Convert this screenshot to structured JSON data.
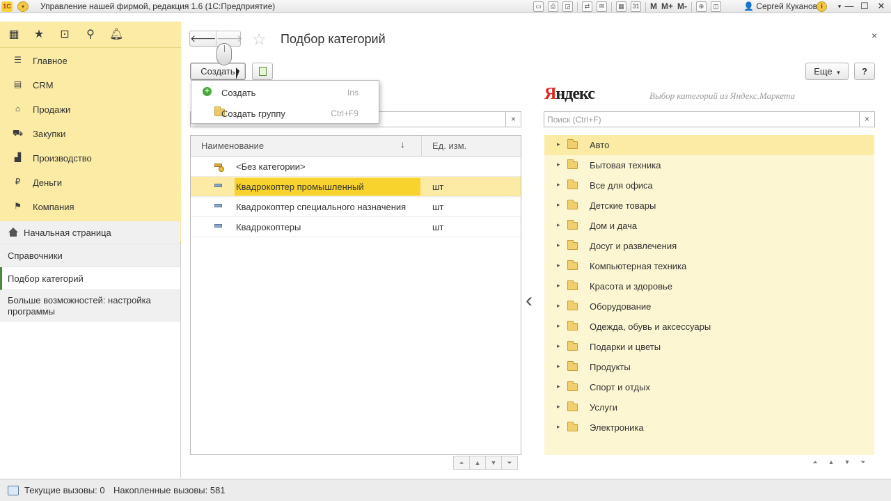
{
  "window": {
    "title": "Управление нашей фирмой, редакция 1.6  (1С:Предприятие)",
    "user": "Сергей Куканов",
    "toolbar_text_icons": [
      "M",
      "M+",
      "M-"
    ],
    "accent_color": "#fbeba4",
    "selection_color": "#f8d32d"
  },
  "sidebar": {
    "top_icons": [
      "apps-grid-icon",
      "star-icon",
      "history-icon",
      "search-icon",
      "bell-icon"
    ],
    "sections": [
      {
        "label": "Главное",
        "icon": "menu-icon"
      },
      {
        "label": "CRM",
        "icon": "crm-icon"
      },
      {
        "label": "Продажи",
        "icon": "basket-icon"
      },
      {
        "label": "Закупки",
        "icon": "cart-icon"
      },
      {
        "label": "Производство",
        "icon": "factory-icon"
      },
      {
        "label": "Деньги",
        "icon": "coin-icon"
      },
      {
        "label": "Компания",
        "icon": "flag-icon"
      }
    ],
    "nav": [
      {
        "label": "Начальная страница"
      },
      {
        "label": "Справочники"
      },
      {
        "label": "Подбор категорий"
      },
      {
        "label": "Больше возможностей: настройка программы"
      }
    ]
  },
  "form": {
    "title": "Подбор категорий",
    "create_label": "Создать",
    "more_label": "Еще",
    "more_arrow": "▾",
    "help_label": "?",
    "close_glyph": "×",
    "back_glyph": "🡐",
    "forward_glyph": "🡒",
    "star_glyph": "☆"
  },
  "dropdown": {
    "items": [
      {
        "label": "Создать",
        "shortcut": "Ins"
      },
      {
        "label": "Создать группу",
        "shortcut": "Ctrl+F9"
      }
    ]
  },
  "left_table": {
    "search_placeholder": "",
    "columns": [
      "Наименование",
      "Ед. изм."
    ],
    "sort_glyph": "↓",
    "rows": [
      {
        "name": "<Без категории>",
        "unit": ""
      },
      {
        "name": "Квадрокоптер промышленный",
        "unit": "шт"
      },
      {
        "name": "Квадрокоптер специального назначения",
        "unit": "шт"
      },
      {
        "name": "Квадрокоптеры",
        "unit": "шт"
      }
    ]
  },
  "yandex": {
    "logo_first": "Я",
    "logo_rest": "ндекс",
    "subtitle": "Выбор категорий из Яндекс.Маркета",
    "search_placeholder": "Поиск (Ctrl+F)",
    "categories": [
      "Авто",
      "Бытовая техника",
      "Все для офиса",
      "Детские товары",
      "Дом и дача",
      "Досуг и развлечения",
      "Компьютерная техника",
      "Красота и здоровье",
      "Оборудование",
      "Одежда, обувь и аксессуары",
      "Подарки и цветы",
      "Продукты",
      "Спорт и отдых",
      "Услуги",
      "Электроника"
    ]
  },
  "statusbar": {
    "current_calls": "Текущие вызовы: 0",
    "accumulated_calls": "Накопленные вызовы: 581"
  }
}
